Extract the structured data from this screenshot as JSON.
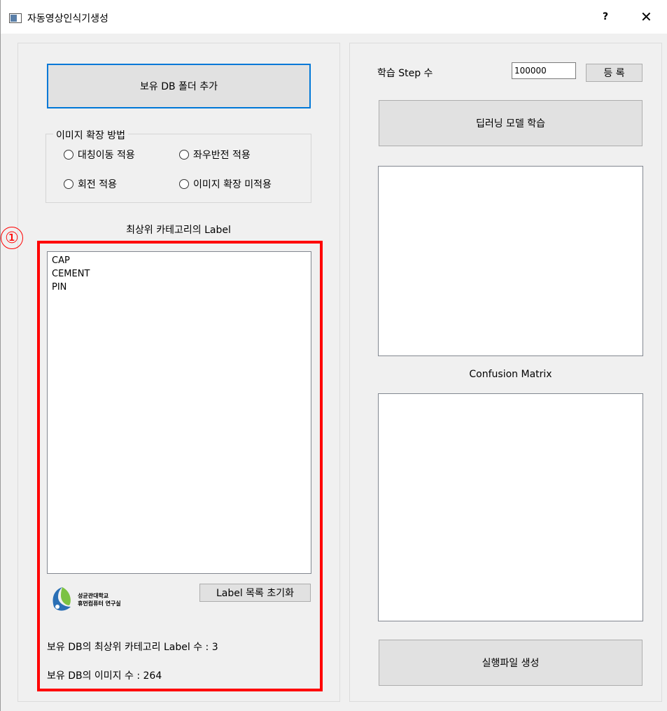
{
  "window": {
    "title": "자동영상인식기생성",
    "help_label": "?",
    "close_label": "✕"
  },
  "left_panel": {
    "add_folder_button": "보유 DB 폴더 추가",
    "augment_group": {
      "title": "이미지 확장 방법",
      "options": [
        "대칭이동 적용",
        "좌우반전 적용",
        "회전 적용",
        "이미지 확장 미적용"
      ]
    },
    "label_list_title": "최상위 카테고리의 Label",
    "labels": [
      "CAP",
      "CEMENT",
      "PIN"
    ],
    "reset_button": "Label 목록 초기화",
    "logo": {
      "line1": "성균관대학교",
      "line2": "휴먼컴퓨터 연구실"
    },
    "label_count_text": "보유 DB의 최상위 카테고리 Label 수 : 3",
    "image_count_text": "보유 DB의 이미지 수 : 264"
  },
  "right_panel": {
    "step_label": "학습 Step 수",
    "step_value": "100000",
    "register_button": "등 록",
    "train_button": "딥러닝 모델 학습",
    "confusion_label": "Confusion Matrix",
    "build_button": "실행파일 생성"
  },
  "annotation": {
    "badge": "①",
    "color": "#ff0000"
  }
}
